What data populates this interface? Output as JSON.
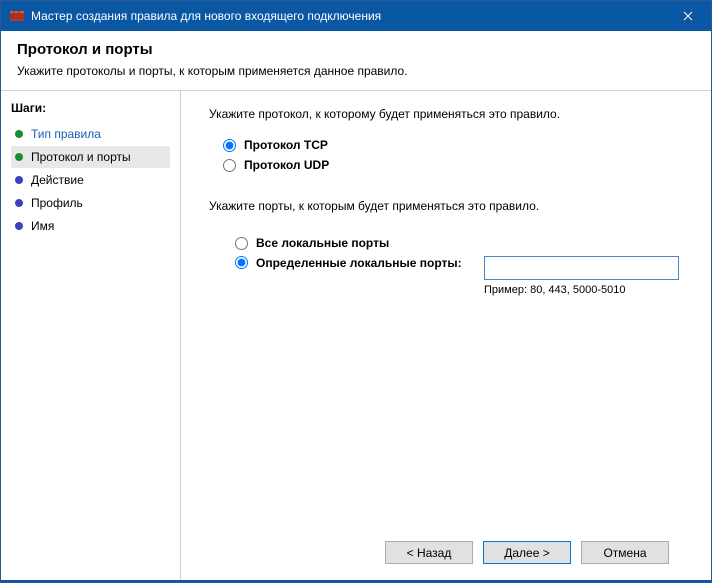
{
  "window": {
    "title": "Мастер создания правила для нового входящего подключения"
  },
  "header": {
    "title": "Протокол и порты",
    "subtitle": "Укажите протоколы и порты, к которым применяется данное правило."
  },
  "sidebar": {
    "title": "Шаги:",
    "steps": [
      {
        "label": "Тип правила",
        "state": "done"
      },
      {
        "label": "Протокол и порты",
        "state": "active"
      },
      {
        "label": "Действие",
        "state": "pending"
      },
      {
        "label": "Профиль",
        "state": "pending"
      },
      {
        "label": "Имя",
        "state": "pending"
      }
    ]
  },
  "main": {
    "protocol_prompt": "Укажите протокол, к которому будет применяться это правило.",
    "protocol_tcp": "Протокол TCP",
    "protocol_udp": "Протокол UDP",
    "protocol_selected": "tcp",
    "ports_prompt": "Укажите порты, к которым будет применяться это правило.",
    "ports_all": "Все локальные порты",
    "ports_specific": "Определенные локальные порты:",
    "ports_selected": "specific",
    "ports_value": "",
    "ports_example": "Пример: 80, 443, 5000-5010"
  },
  "footer": {
    "back": "< Назад",
    "next": "Далее >",
    "cancel": "Отмена"
  }
}
